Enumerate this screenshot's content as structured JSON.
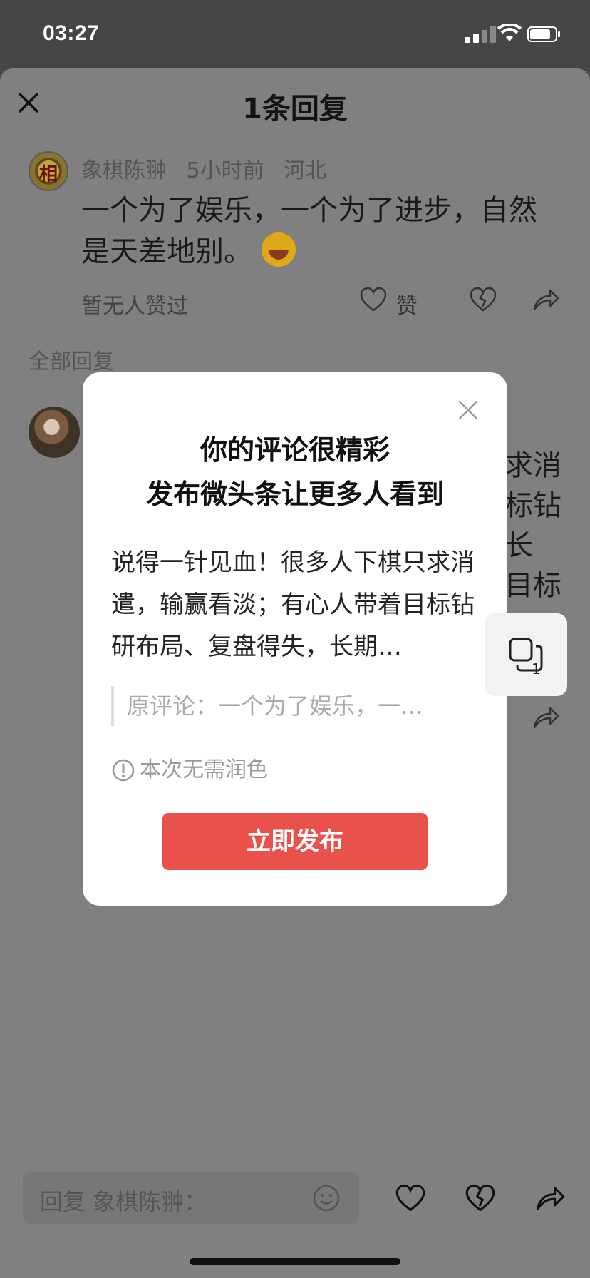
{
  "status_bar": {
    "time": "03:27"
  },
  "sheet": {
    "title": "1条回复",
    "comment": {
      "author": "象棋陈翀",
      "time": "5小时前",
      "location": "河北",
      "avatar_char": "相",
      "text": "一个为了娱乐，一个为了进步，自然是天差地别。",
      "likes_none": "暂无人赞过",
      "like_label": "赞"
    },
    "all_replies_label": "全部回复",
    "background_fragments": [
      "求消",
      "标钻",
      "长",
      "目标"
    ]
  },
  "bottom_bar": {
    "reply_placeholder": "回复 象棋陈翀："
  },
  "modal": {
    "title_line1": "你的评论很精彩",
    "title_line2": "发布微头条让更多人看到",
    "body": "说得一针见血！很多人下棋只求消遣，输赢看淡；有心人带着目标钻研布局、复盘得失，长期…",
    "quote": "原评论：一个为了娱乐，一…",
    "notice": "本次无需润色",
    "publish_label": "立即发布"
  },
  "floating_button": {
    "count": "1"
  },
  "colors": {
    "accent": "#e9524a",
    "overlay": "#808080",
    "modal_bg": "#ffffff"
  }
}
